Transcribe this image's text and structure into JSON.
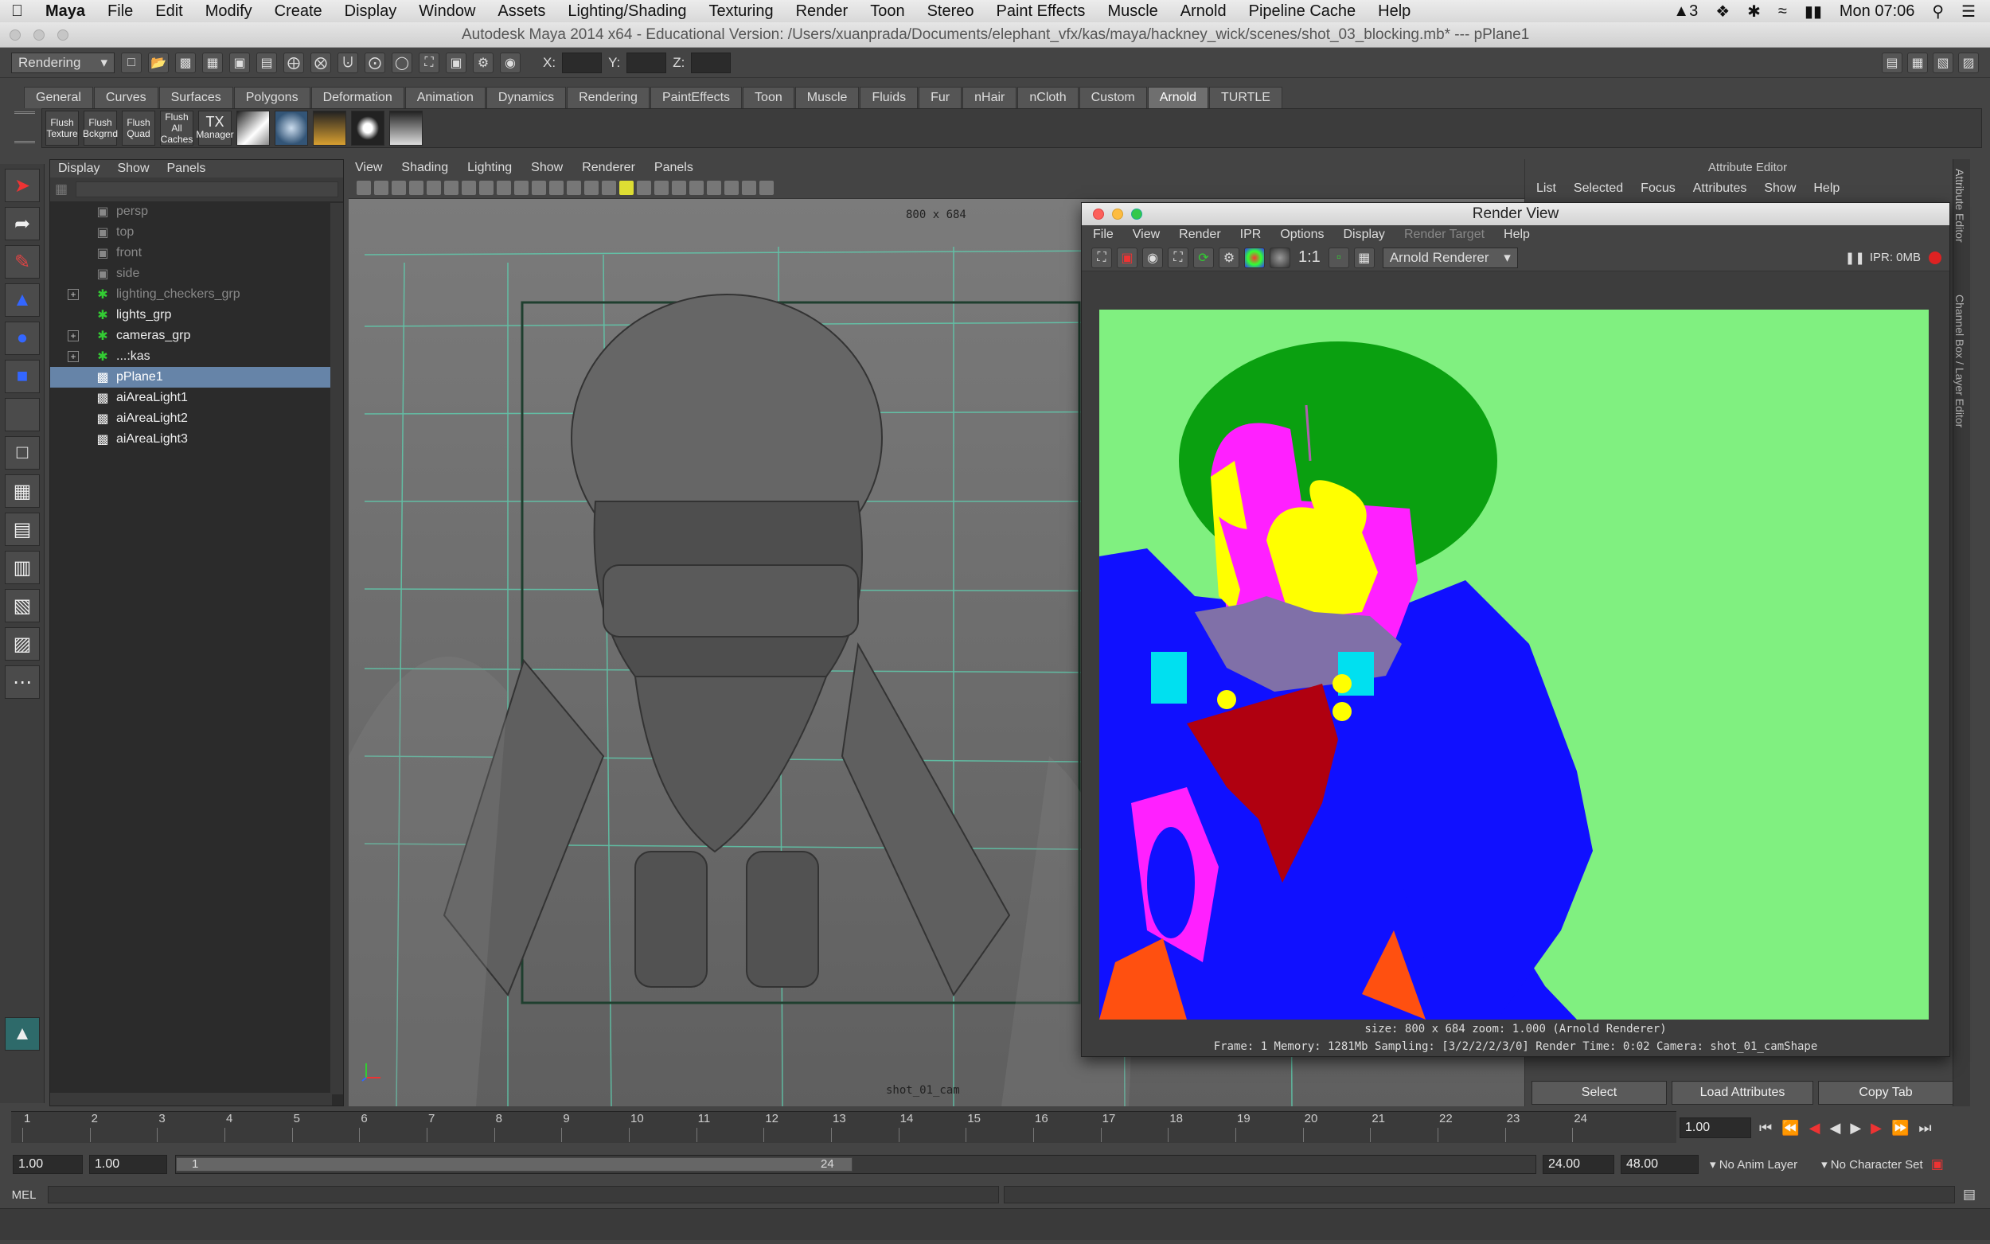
{
  "macbar": {
    "apple_icon": "apple-icon",
    "app": "Maya",
    "menus": [
      "File",
      "Edit",
      "Modify",
      "Create",
      "Display",
      "Window",
      "Assets",
      "Lighting/Shading",
      "Texturing",
      "Render",
      "Toon",
      "Stereo",
      "Paint Effects",
      "Muscle",
      "Arnold",
      "Pipeline Cache",
      "Help"
    ],
    "status_ai": "3",
    "clock": "Mon 07:06"
  },
  "titlebar": {
    "title": "Autodesk Maya 2014 x64 - Educational Version: /Users/xuanprada/Documents/elephant_vfx/kas/maya/hackney_wick/scenes/shot_03_blocking.mb*  ---  pPlane1"
  },
  "statusline": {
    "menuset": "Rendering",
    "x_label": "X:",
    "y_label": "Y:",
    "z_label": "Z:"
  },
  "shelf": {
    "tabs": [
      "General",
      "Curves",
      "Surfaces",
      "Polygons",
      "Deformation",
      "Animation",
      "Dynamics",
      "Rendering",
      "PaintEffects",
      "Toon",
      "Muscle",
      "Fluids",
      "Fur",
      "nHair",
      "nCloth",
      "Custom",
      "Arnold",
      "TURTLE"
    ],
    "active_tab": "Arnold",
    "buttons": [
      {
        "line1": "Flush",
        "line2": "Texture"
      },
      {
        "line1": "Flush",
        "line2": "Bckgrnd"
      },
      {
        "line1": "Flush",
        "line2": "Quad"
      },
      {
        "line1": "Flush",
        "line2": "All Caches"
      },
      {
        "line1": "TX",
        "line2": "Manager"
      }
    ]
  },
  "outliner": {
    "menus": [
      "Display",
      "Show",
      "Panels"
    ],
    "items": [
      {
        "label": "persp",
        "type": "camera",
        "dim": true
      },
      {
        "label": "top",
        "type": "camera",
        "dim": true
      },
      {
        "label": "front",
        "type": "camera",
        "dim": true
      },
      {
        "label": "side",
        "type": "camera",
        "dim": true
      },
      {
        "label": "lighting_checkers_grp",
        "type": "group",
        "dim": true,
        "expand": "+"
      },
      {
        "label": "lights_grp",
        "type": "group",
        "dim": false,
        "expand": ""
      },
      {
        "label": "cameras_grp",
        "type": "group",
        "dim": false,
        "expand": "+"
      },
      {
        "label": "...:kas",
        "type": "group",
        "dim": false,
        "expand": "+"
      },
      {
        "label": "pPlane1",
        "type": "mesh",
        "dim": false,
        "selected": true
      },
      {
        "label": "aiAreaLight1",
        "type": "light",
        "dim": false
      },
      {
        "label": "aiAreaLight2",
        "type": "light",
        "dim": false
      },
      {
        "label": "aiAreaLight3",
        "type": "light",
        "dim": false
      }
    ]
  },
  "viewport": {
    "menus": [
      "View",
      "Shading",
      "Lighting",
      "Show",
      "Renderer",
      "Panels"
    ],
    "resolution": "800 x 684",
    "camera": "shot_01_cam"
  },
  "attribute_editor": {
    "title": "Attribute Editor",
    "menus": [
      "List",
      "Selected",
      "Focus",
      "Attributes",
      "Show",
      "Help"
    ],
    "buttons": [
      "Select",
      "Load Attributes",
      "Copy Tab"
    ],
    "side_tabs": [
      "Attribute Editor",
      "Channel Box / Layer Editor"
    ]
  },
  "render_view": {
    "title": "Render View",
    "menus": [
      "File",
      "View",
      "Render",
      "IPR",
      "Options",
      "Display",
      "Render Target",
      "Help"
    ],
    "renderer": "Arnold Renderer",
    "ratio": "1:1",
    "ipr": "IPR: 0MB",
    "info1": "size: 800 x 684 zoom: 1.000   (Arnold Renderer)",
    "info2": "Frame: 1   Memory: 1281Mb   Sampling: [3/2/2/2/3/0]   Render Time: 0:02   Camera: shot_01_camShape",
    "colors": {
      "bg": "#80f080",
      "green": "#0aa010",
      "magenta": "#ff20ff",
      "yellow": "#ffff00",
      "blue": "#1010ff",
      "cyan": "#00e0f0",
      "red": "#b00010",
      "purple": "#8070a8",
      "orange": "#ff5010"
    }
  },
  "timeline": {
    "ticks": [
      "1",
      "2",
      "3",
      "4",
      "5",
      "6",
      "7",
      "8",
      "9",
      "10",
      "11",
      "12",
      "13",
      "14",
      "15",
      "16",
      "17",
      "18",
      "19",
      "20",
      "21",
      "22",
      "23",
      "24"
    ],
    "current": "1.00"
  },
  "range": {
    "start": "1.00",
    "start2": "1.00",
    "slider_start": "1",
    "slider_end": "24",
    "end": "24.00",
    "end2": "48.00",
    "anim_layer": "No Anim Layer",
    "char_set": "No Character Set"
  },
  "cmd": {
    "label": "MEL"
  }
}
